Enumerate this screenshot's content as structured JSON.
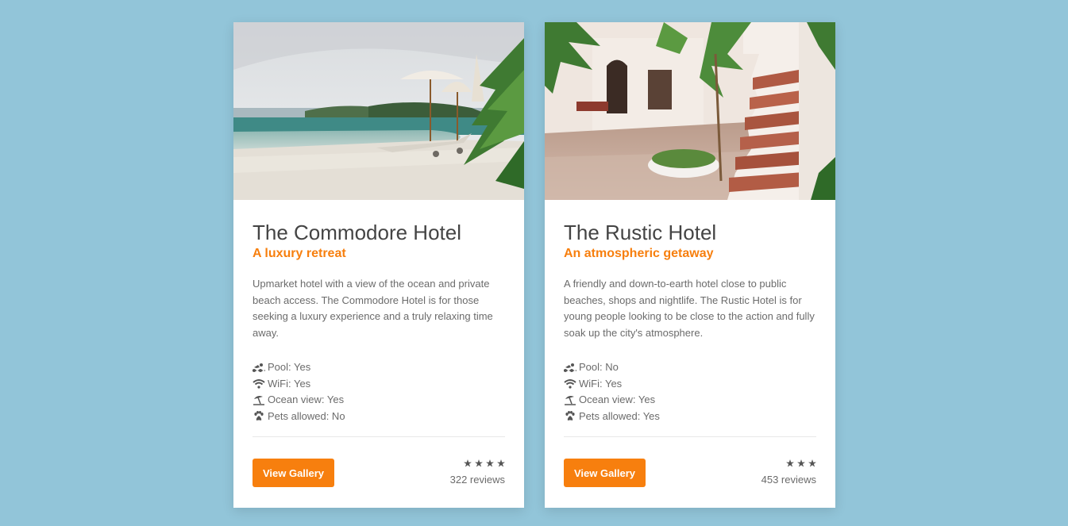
{
  "cards": [
    {
      "title": "The Commodore Hotel",
      "subtitle": "A luxury retreat",
      "description": "Upmarket hotel with a view of the ocean and private beach access. The Commodore Hotel is for those seeking a luxury experience and a truly relaxing time away.",
      "photo_icon": "pool-beach-photo",
      "amenities": [
        {
          "icon": "swimmer-icon",
          "label": "Pool: Yes"
        },
        {
          "icon": "wifi-icon",
          "label": "WiFi: Yes"
        },
        {
          "icon": "umbrella-beach-icon",
          "label": "Ocean view: Yes"
        },
        {
          "icon": "paw-icon",
          "label": "Pets allowed: No"
        }
      ],
      "button_label": "View Gallery",
      "stars": 4,
      "reviews": "322 reviews"
    },
    {
      "title": "The Rustic Hotel",
      "subtitle": "An atmospheric getaway",
      "description": "A friendly and down-to-earth hotel close to public beaches, shops and nightlife. The Rustic Hotel is for young people looking to be close to the action and fully soak up the city's atmosphere.",
      "photo_icon": "courtyard-stairs-photo",
      "amenities": [
        {
          "icon": "swimmer-icon",
          "label": "Pool: No"
        },
        {
          "icon": "wifi-icon",
          "label": "WiFi: Yes"
        },
        {
          "icon": "umbrella-beach-icon",
          "label": "Ocean view: Yes"
        },
        {
          "icon": "paw-icon",
          "label": "Pets allowed: Yes"
        }
      ],
      "button_label": "View Gallery",
      "stars": 3,
      "reviews": "453 reviews"
    }
  ],
  "colors": {
    "background": "#92c5d9",
    "accent": "#f77f0e",
    "title": "#444444",
    "text": "#6b6b6b"
  }
}
